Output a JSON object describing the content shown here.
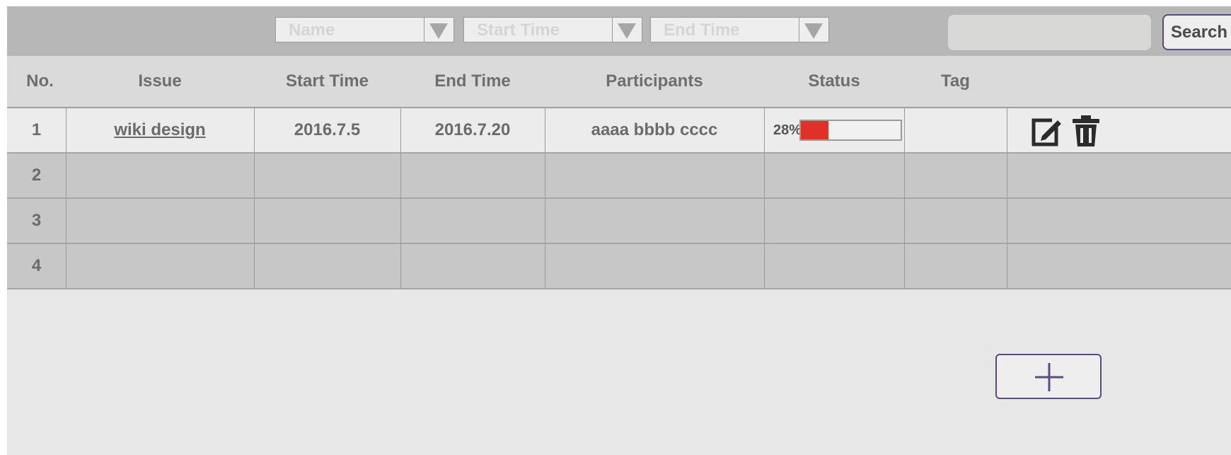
{
  "filters": {
    "name_placeholder": "Name",
    "start_placeholder": "Start Time",
    "end_placeholder": "End Time",
    "search_value": "",
    "search_label": "Search"
  },
  "table": {
    "headers": [
      "No.",
      "Issue",
      "Start Time",
      "End Time",
      "Participants",
      "Status",
      "Tag"
    ],
    "rows": [
      {
        "no": "1",
        "issue": "wiki design",
        "start": "2016.7.5",
        "end": "2016.7.20",
        "participants": "aaaa bbbb cccc",
        "status_text": "28%",
        "progress": 0.28,
        "tag": ""
      },
      {
        "no": "2",
        "issue": "",
        "start": "",
        "end": "",
        "participants": "",
        "status_text": "",
        "tag": ""
      },
      {
        "no": "3",
        "issue": "",
        "start": "",
        "end": "",
        "participants": "",
        "status_text": "",
        "tag": ""
      },
      {
        "no": "4",
        "issue": "",
        "start": "",
        "end": "",
        "participants": "",
        "status_text": "",
        "tag": ""
      }
    ]
  },
  "icons": {
    "edit": "edit-icon",
    "delete": "trash-icon",
    "add": "plus-icon",
    "dropdown": "triangle-down-icon"
  },
  "colors": {
    "progress_fill": "#e03027",
    "button_border": "#5b4a86"
  }
}
